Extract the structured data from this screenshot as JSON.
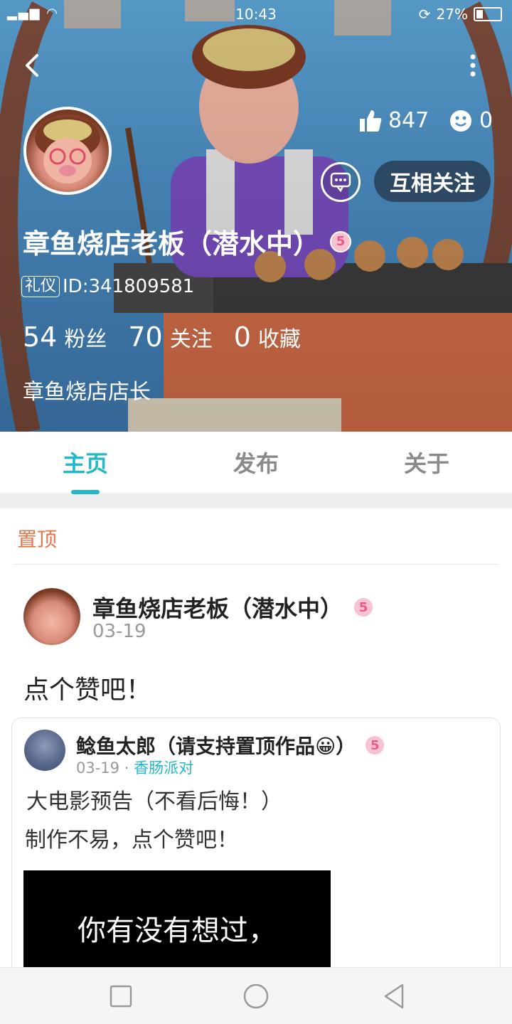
{
  "status_bar": {
    "time": "10:43",
    "battery_percent": "27%",
    "battery_level": 0.27
  },
  "profile": {
    "username": "章鱼烧店老板（潜水中）",
    "level": "5",
    "tag": "礼仪",
    "id_text": "ID:341809581",
    "likes": "847",
    "smiles": "0",
    "follow_button": "互相关注",
    "stats": [
      {
        "num": "54",
        "label": "粉丝"
      },
      {
        "num": "70",
        "label": "关注"
      },
      {
        "num": "0",
        "label": "收藏"
      }
    ],
    "bio": "章鱼烧店店长"
  },
  "tabs": [
    {
      "label": "主页",
      "active": true
    },
    {
      "label": "发布",
      "active": false
    },
    {
      "label": "关于",
      "active": false
    }
  ],
  "pinned_label": "置顶",
  "post": {
    "author": "章鱼烧店老板（潜水中）",
    "level": "5",
    "date": "03-19",
    "text": "点个赞吧！",
    "repost": {
      "author": "鲶鱼太郎（请支持置顶作品😀）",
      "level": "5",
      "date": "03-19",
      "separator": "·",
      "topic": "香肠派对",
      "line1": "大电影预告（不看后悔！）",
      "line2": "制作不易，点个赞吧！",
      "video_caption": "你有没有想过，"
    }
  },
  "colors": {
    "accent": "#22b8c8",
    "pinned": "#e8734a"
  }
}
